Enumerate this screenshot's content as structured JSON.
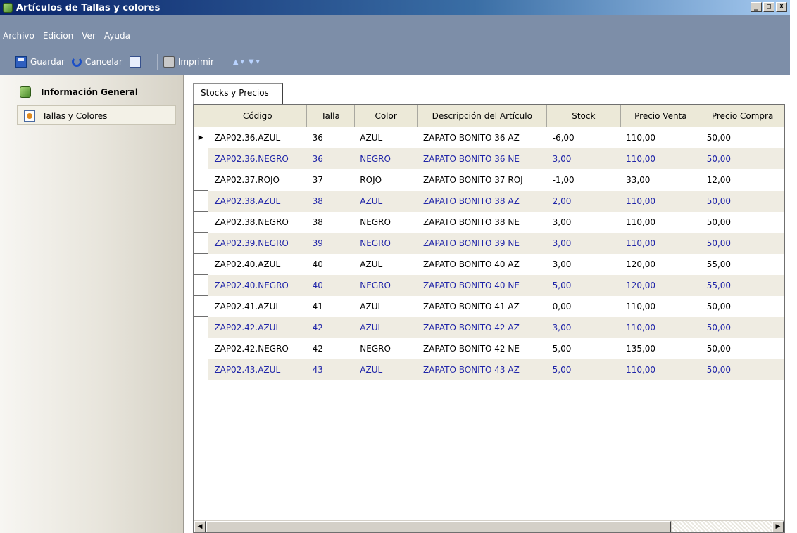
{
  "window": {
    "title": "Artículos de Tallas y colores",
    "controls": [
      "_",
      "□",
      "X"
    ]
  },
  "menu": {
    "items": [
      "Archivo",
      "Edicion",
      "Ver",
      "Ayuda"
    ]
  },
  "toolbar": {
    "save_label": "Guardar",
    "cancel_label": "Cancelar",
    "print_label": "Imprimir"
  },
  "sidebar": {
    "items": [
      {
        "label": "Información General",
        "icon": "cube-icon"
      },
      {
        "label": "Tallas y Colores",
        "icon": "palette-icon"
      }
    ]
  },
  "tabs": {
    "active": "Stocks y Precios"
  },
  "grid": {
    "columns": [
      "Código",
      "Talla",
      "Color",
      "Descripción del Artículo",
      "Stock",
      "Precio Venta",
      "Precio Compra"
    ],
    "rows": [
      [
        "ZAP02.36.AZUL",
        "36",
        "AZUL",
        "ZAPATO BONITO 36 AZ",
        "-6,00",
        "110,00",
        "50,00"
      ],
      [
        "ZAP02.36.NEGRO",
        "36",
        "NEGRO",
        "ZAPATO BONITO 36 NE",
        "3,00",
        "110,00",
        "50,00"
      ],
      [
        "ZAP02.37.ROJO",
        "37",
        "ROJO",
        "ZAPATO BONITO 37 ROJ",
        "-1,00",
        "33,00",
        "12,00"
      ],
      [
        "ZAP02.38.AZUL",
        "38",
        "AZUL",
        "ZAPATO BONITO 38 AZ",
        "2,00",
        "110,00",
        "50,00"
      ],
      [
        "ZAP02.38.NEGRO",
        "38",
        "NEGRO",
        "ZAPATO BONITO 38 NE",
        "3,00",
        "110,00",
        "50,00"
      ],
      [
        "ZAP02.39.NEGRO",
        "39",
        "NEGRO",
        "ZAPATO BONITO 39 NE",
        "3,00",
        "110,00",
        "50,00"
      ],
      [
        "ZAP02.40.AZUL",
        "40",
        "AZUL",
        "ZAPATO BONITO 40 AZ",
        "3,00",
        "120,00",
        "55,00"
      ],
      [
        "ZAP02.40.NEGRO",
        "40",
        "NEGRO",
        "ZAPATO BONITO 40 NE",
        "5,00",
        "120,00",
        "55,00"
      ],
      [
        "ZAP02.41.AZUL",
        "41",
        "AZUL",
        "ZAPATO BONITO 41 AZ",
        "0,00",
        "110,00",
        "50,00"
      ],
      [
        "ZAP02.42.AZUL",
        "42",
        "AZUL",
        "ZAPATO BONITO 42 AZ",
        "3,00",
        "110,00",
        "50,00"
      ],
      [
        "ZAP02.42.NEGRO",
        "42",
        "NEGRO",
        "ZAPATO BONITO 42 NE",
        "5,00",
        "135,00",
        "50,00"
      ],
      [
        "ZAP02.43.AZUL",
        "43",
        "AZUL",
        "ZAPATO BONITO 43 AZ",
        "5,00",
        "110,00",
        "50,00"
      ]
    ],
    "selected_row": 0
  },
  "colors": {
    "title_bar": "#0a246a",
    "toolbar_bg": "#7d8ea8",
    "alt_row_bg": "#efece2",
    "alt_row_text": "#1f24a8"
  }
}
